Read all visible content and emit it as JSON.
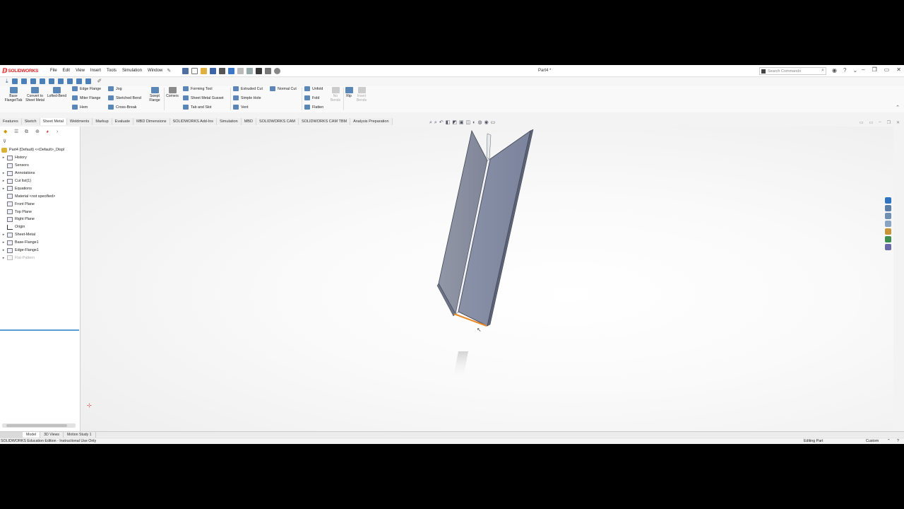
{
  "app": {
    "logo_text": "SOLIDWORKS",
    "document_title": "Part4 *"
  },
  "menus": [
    "File",
    "Edit",
    "View",
    "Insert",
    "Tools",
    "Simulation",
    "Window"
  ],
  "search": {
    "placeholder": "Search Commands"
  },
  "command_manager": {
    "base_flange": "Base Flange/Tab",
    "convert": "Convert to Sheet Metal",
    "lofted_bend": "Lofted-Bend",
    "edge_flange": "Edge Flange",
    "miter_flange": "Miter Flange",
    "hem": "Hem",
    "jog": "Jog",
    "sketched_bend": "Sketched Bend",
    "cross_break": "Cross-Break",
    "swept_flange": "Swept Flange",
    "corners": "Corners",
    "forming_tool": "Forming Tool",
    "sheet_metal_gusset": "Sheet Metal Gusset",
    "tab_and_slot": "Tab and Slot",
    "extruded_cut": "Extruded Cut",
    "simple_hole": "Simple Hole",
    "vent": "Vent",
    "normal_cut": "Normal Cut",
    "unfold": "Unfold",
    "fold": "Fold",
    "flatten": "Flatten",
    "no_bends": "No Bends",
    "rip": "Rip",
    "insert_bends": "Insert Bends"
  },
  "tabs": [
    "Features",
    "Sketch",
    "Sheet Metal",
    "Weldments",
    "Markup",
    "Evaluate",
    "MBD Dimensions",
    "SOLIDWORKS Add-Ins",
    "Simulation",
    "MBD",
    "SOLIDWORKS CAM",
    "SOLIDWORKS CAM TBM",
    "Analysis Preparation"
  ],
  "active_tab": "Sheet Metal",
  "tree": {
    "root": "Part4 (Default) <<Default>_Displ",
    "items": [
      {
        "label": "History",
        "expandable": true
      },
      {
        "label": "Sensors",
        "expandable": false
      },
      {
        "label": "Annotations",
        "expandable": true
      },
      {
        "label": "Cut list(1)",
        "expandable": true
      },
      {
        "label": "Equations",
        "expandable": true
      },
      {
        "label": "Material <not specified>",
        "expandable": false
      },
      {
        "label": "Front Plane",
        "expandable": false
      },
      {
        "label": "Top Plane",
        "expandable": false
      },
      {
        "label": "Right Plane",
        "expandable": false
      },
      {
        "label": "Origin",
        "expandable": false
      },
      {
        "label": "Sheet-Metal",
        "expandable": true
      },
      {
        "label": "Base-Flange1",
        "expandable": true
      },
      {
        "label": "Edge-Flange1",
        "expandable": true
      },
      {
        "label": "Flat-Pattern",
        "expandable": true,
        "suppressed": true
      }
    ]
  },
  "bottom_tabs": [
    "Model",
    "3D Views",
    "Motion Study 1"
  ],
  "active_bottom_tab": "Model",
  "status": {
    "left": "SOLIDWORKS Education Edition - Instructional Use Only",
    "mode": "Editing Part",
    "units": "Custom"
  },
  "colors": {
    "accent": "#d22222",
    "model_face": "#8891a6",
    "selected_edge": "#e8892a"
  }
}
